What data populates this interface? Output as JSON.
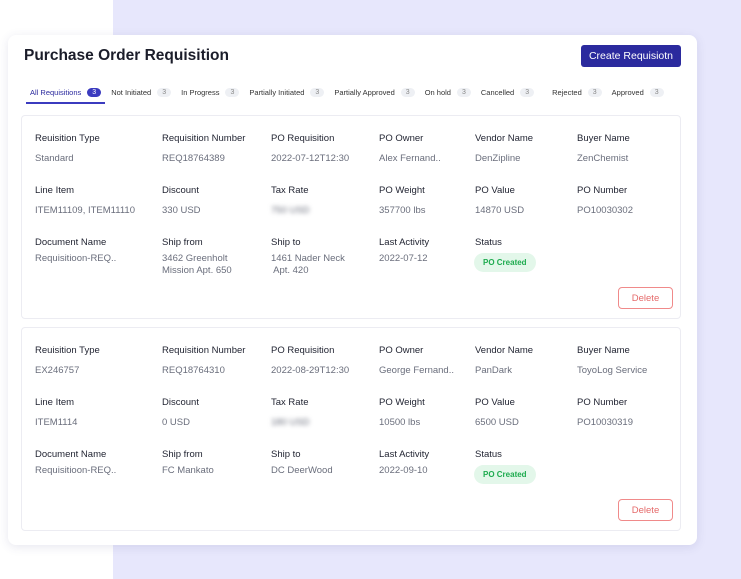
{
  "header": {
    "title": "Purchase Order Requisition",
    "create_label": "Create Requisiotn"
  },
  "tabs": [
    {
      "label": "All Requisitions",
      "count": "3",
      "active": true
    },
    {
      "label": "Not Initiated",
      "count": "3"
    },
    {
      "label": "In Progress",
      "count": "3"
    },
    {
      "label": "Partially Initiated",
      "count": "3"
    },
    {
      "label": "Partially Approved",
      "count": "3"
    },
    {
      "label": "On hold",
      "count": "3"
    },
    {
      "label": "Cancelled",
      "count": "3"
    },
    {
      "label": "Rejected",
      "count": "3"
    },
    {
      "label": "Approved",
      "count": "3"
    }
  ],
  "labels": [
    "Reuisition Type",
    "Requisition Number",
    "PO Requisition",
    "PO Owner",
    "Vendor Name",
    "Buyer Name",
    "Line Item",
    "Discount",
    "Tax Rate",
    "PO Weight",
    "PO Value",
    "PO Number",
    "Document Name",
    "Ship from",
    "Ship to",
    "Last Activity",
    "Status"
  ],
  "records": [
    {
      "values": [
        "Standard",
        "REQ18764389",
        "2022-07-12T12:30",
        "Alex Fernand..",
        "DenZipline",
        "ZenChemist",
        "ITEM11109, ITEM11110",
        "330 USD",
        "750 USD",
        "357700 lbs",
        "14870 USD",
        "PO10030302",
        "Requisitioon-REQ..",
        "3462 Greenholt\nMission Apt. 650",
        "1461 Nader Neck\n Apt. 420",
        "2022-07-12"
      ],
      "status": "PO Created",
      "delete_label": "Delete"
    },
    {
      "values": [
        "EX246757",
        "REQ18764310",
        "2022-08-29T12:30",
        "George Fernand..",
        "PanDark",
        "ToyoLog Service",
        "ITEM1114",
        "0 USD",
        "180 USD",
        "10500 lbs",
        "6500 USD",
        "PO10030319",
        "Requisitioon-REQ..",
        "FC Mankato",
        "DC DeerWood",
        "2022-09-10"
      ],
      "status": "PO Created",
      "delete_label": "Delete"
    }
  ],
  "colors": {
    "accent": "#2b2a9e",
    "status_green": "#1eab4f",
    "delete_red": "#e56a6a",
    "background_lavender": "#e7e7fc"
  }
}
